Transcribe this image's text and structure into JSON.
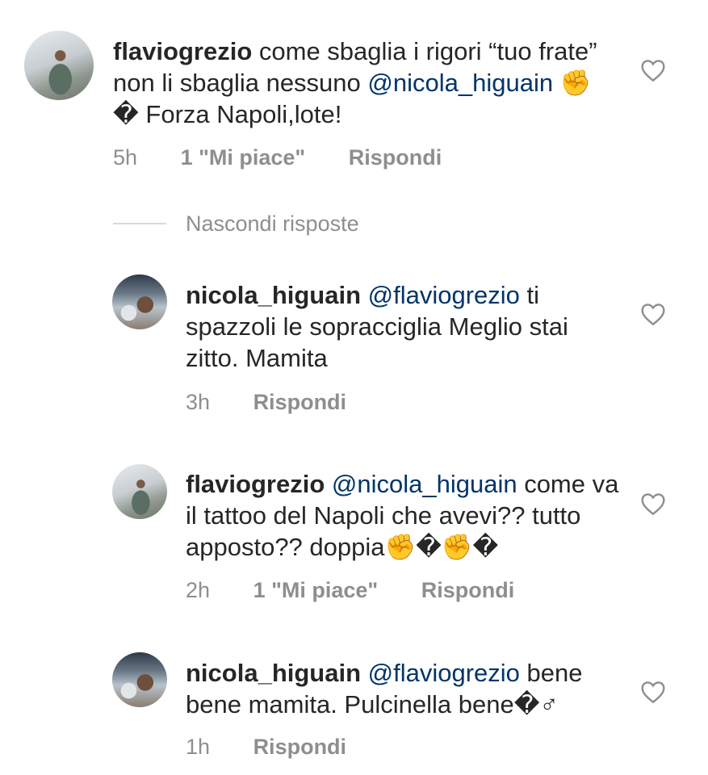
{
  "comments": [
    {
      "username": "flaviogrezio",
      "text_before": "come sbaglia i rigori “tuo frate” non li sbaglia nessuno ",
      "mention": "@nicola_higuain",
      "text_after": " ✊� Forza Napoli,lote!",
      "time": "5h",
      "likes": "1 \"Mi piace\"",
      "reply": "Rispondi"
    },
    {
      "username": "nicola_higuain",
      "mention": "@flaviogrezio",
      "text_after": " ti spazzoli le sopracciglia Meglio stai zitto. Mamita",
      "time": "3h",
      "reply": "Rispondi"
    },
    {
      "username": "flaviogrezio",
      "mention": "@nicola_higuain",
      "text_after": " come va il tattoo del Napoli che avevi?? tutto apposto?? doppia✊�✊�",
      "time": "2h",
      "likes": "1 \"Mi piace\"",
      "reply": "Rispondi"
    },
    {
      "username": "nicola_higuain",
      "mention": "@flaviogrezio",
      "text_after": " bene bene mamita. Pulcinella bene�♂",
      "time": "1h",
      "reply": "Rispondi"
    }
  ],
  "hide_replies": "Nascondi risposte",
  "icons": {
    "like": "heart-outline-icon",
    "avatar": "user-avatar"
  },
  "colors": {
    "text": "#262626",
    "mention": "#003569",
    "meta": "#8e8e8e"
  }
}
